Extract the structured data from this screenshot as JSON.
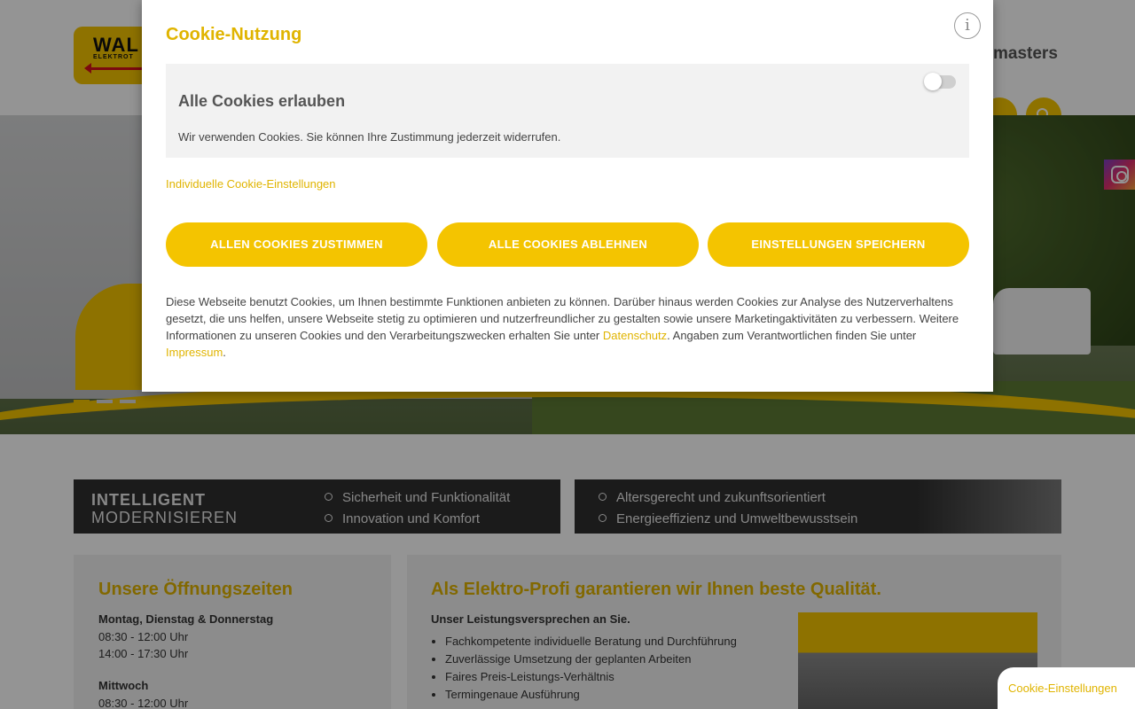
{
  "site": {
    "logo_text": "WAL",
    "logo_sub": "ELEKTROT",
    "partner_text": "masters"
  },
  "banners": {
    "left": {
      "title_1": "INTELLIGENT",
      "title_2": "MODERNISIEREN",
      "items": [
        "Sicherheit und Funktionalität",
        "Innovation und Komfort"
      ]
    },
    "right": {
      "items": [
        "Altersgerecht und zukunftsorientiert",
        "Energieeffizienz und Umweltbewusstsein"
      ]
    }
  },
  "hours": {
    "heading": "Unsere Öffnungszeiten",
    "days": [
      {
        "day": "Montag, Dienstag & Donnerstag",
        "times": [
          "08:30 - 12:00 Uhr",
          "14:00 - 17:30 Uhr"
        ]
      },
      {
        "day": "Mittwoch",
        "times": [
          "08:30 - 12:00 Uhr"
        ]
      }
    ]
  },
  "about": {
    "heading": "Als Elektro-Profi garantieren wir Ihnen beste Qualität.",
    "lead": "Unser Leistungsversprechen an Sie.",
    "items": [
      "Fachkompetente individuelle Beratung und Durchführung",
      "Zuverlässige Umsetzung der geplanten Arbeiten",
      "Faires Preis-Leistungs-Verhältnis",
      "Termingenaue Ausführung"
    ]
  },
  "cookie_tab": "Cookie-Einstellungen",
  "modal": {
    "title": "Cookie-Nutzung",
    "info_icon": "i",
    "panel_title": "Alle Cookies erlauben",
    "panel_text": "Wir verwenden Cookies. Sie können Ihre Zustimmung jederzeit widerrufen.",
    "toggle_on": false,
    "individual_link": "Individuelle Cookie-Einstellungen",
    "buttons": {
      "accept_all": "ALLEN COOKIES ZUSTIMMEN",
      "reject_all": "ALLE COOKIES ABLEHNEN",
      "save": "EINSTELLUNGEN SPEICHERN"
    },
    "description_part1": "Diese Webseite benutzt Cookies, um Ihnen bestimmte Funktionen anbieten zu können. Darüber hinaus werden Cookies zur Analyse des Nutzerverhaltens gesetzt, die uns helfen, unsere Webseite stetig zu optimieren und nutzerfreundlicher zu gestalten sowie unsere Marketingaktivitäten zu verbessern. Weitere Informationen zu unseren Cookies und den Verarbeitungszwecken erhalten Sie unter ",
    "privacy_link": "Datenschutz",
    "description_part2": ". Angaben zum Verantwortlichen finden Sie unter ",
    "imprint_link": "Impressum",
    "description_part3": "."
  },
  "colors": {
    "accent": "#f4c400",
    "accent_text": "#e0b400",
    "overlay": "rgba(0,0,0,0.42)"
  },
  "icons": [
    "search-icon",
    "instagram-icon",
    "info-icon",
    "toggle-switch"
  ]
}
